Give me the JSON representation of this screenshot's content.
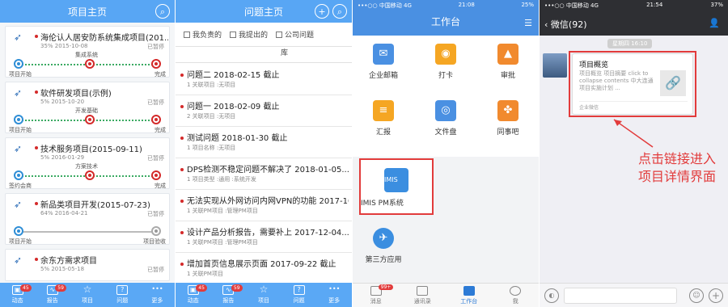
{
  "p1": {
    "header_title": "项目主页",
    "projects": [
      {
        "title": "海伦认人居安防系统集成项目(201...",
        "progress": "35%",
        "date": "2015-10-08",
        "status": "已暂停",
        "milestone": "集成系统",
        "start": "项目开始",
        "end": "完成"
      },
      {
        "title": "软件研发项目(示例)",
        "progress": "5%",
        "date": "2015-10-20",
        "status": "已暂停",
        "milestone": "开发基础",
        "start": "项目开始",
        "end": "完成"
      },
      {
        "title": "技术服务项目(2015-09-11)",
        "progress": "5%",
        "date": "2016-01-29",
        "status": "已暂停",
        "milestone": "方案技术",
        "start": "签约会商",
        "end": "完成"
      },
      {
        "title": "新品类项目开发(2015-07-23)",
        "progress": "64%",
        "date": "2016-04-21",
        "status": "已暂停",
        "milestone": "",
        "start": "项目开始",
        "end": "项目验收"
      },
      {
        "title": "余东方需求项目",
        "progress": "5%",
        "date": "2015-05-18",
        "status": "已暂停",
        "milestone": "",
        "start": "",
        "end": ""
      }
    ],
    "tabs": [
      {
        "label": "动态",
        "badge": "45"
      },
      {
        "label": "报告",
        "badge": "59"
      },
      {
        "label": "项目",
        "badge": ""
      },
      {
        "label": "问题",
        "badge": ""
      },
      {
        "label": "更多",
        "badge": ""
      }
    ]
  },
  "p2": {
    "header_title": "问题主页",
    "filter_1": "我负责的",
    "filter_2": "我提出的",
    "filter_3": "公司问题",
    "filter_4": "库",
    "issues": [
      {
        "title": "问题二 2018-02-15 截止",
        "sub": "1 关联项目 :无项目"
      },
      {
        "title": "问题一 2018-02-09 截止",
        "sub": "2 关联项目 :无项目"
      },
      {
        "title": "测试问题 2018-01-30 截止",
        "sub": "1 项目名称 :无项目"
      },
      {
        "title": "DPS检测不稳定问题不解决了 2018-01-05...",
        "sub": "1 项目类型 :通用 :系统开发"
      },
      {
        "title": "无法实现从外网访问内网VPN的功能 2017-10-...",
        "sub": "1 关联PM项目 :管理PM项目"
      },
      {
        "title": "设计产品分析报告，需要补上 2017-12-04...",
        "sub": "1 关联PM项目 :管理PM项目"
      },
      {
        "title": "增加首页信息展示页面 2017-09-22 截止",
        "sub": "1 关联PM项目"
      }
    ],
    "tabs": [
      {
        "label": "动态",
        "badge": "45"
      },
      {
        "label": "报告",
        "badge": "59"
      },
      {
        "label": "项目",
        "badge": ""
      },
      {
        "label": "问题",
        "badge": ""
      },
      {
        "label": "更多",
        "badge": ""
      }
    ]
  },
  "p3": {
    "carrier": "•••○○ 中国移动 4G",
    "time": "21:08",
    "battery": "25%",
    "header_title": "工作台",
    "apps": [
      {
        "label": "企业邮箱",
        "color": "#4a90e2",
        "icon": "mail-icon",
        "glyph": "✉"
      },
      {
        "label": "打卡",
        "color": "#f5a623",
        "icon": "location-pin-icon",
        "glyph": "◉"
      },
      {
        "label": "审批",
        "color": "#f18a2e",
        "icon": "stamp-icon",
        "glyph": "▲"
      },
      {
        "label": "汇报",
        "color": "#f5a623",
        "icon": "report-icon",
        "glyph": "≡"
      },
      {
        "label": "文件盘",
        "color": "#4a90e2",
        "icon": "database-icon",
        "glyph": "◎"
      },
      {
        "label": "同事吧",
        "color": "#f18a2e",
        "icon": "share-icon",
        "glyph": "✤"
      }
    ],
    "imis_label": "IMIS PM系统",
    "imis_icon_text": "IMIS",
    "third_party": "第三方应用",
    "tabs": [
      {
        "label": "消息",
        "badge": "99+"
      },
      {
        "label": "通讯录",
        "badge": ""
      },
      {
        "label": "工作台",
        "badge": ""
      },
      {
        "label": "我",
        "badge": ""
      }
    ]
  },
  "p4": {
    "carrier": "•••○○ 中国移动 4G",
    "time": "21:54",
    "battery": "37%",
    "back_label": "微信(92)",
    "time_pill": "星期四 16:10",
    "card_title": "项目概览",
    "card_desc": "项目概览 项目摘要 click to collapse contents 中大连通项目实施计划 ...",
    "card_footer": "企业微信",
    "annotation": "点击链接进入项目详情界面",
    "input_placeholder": ""
  }
}
